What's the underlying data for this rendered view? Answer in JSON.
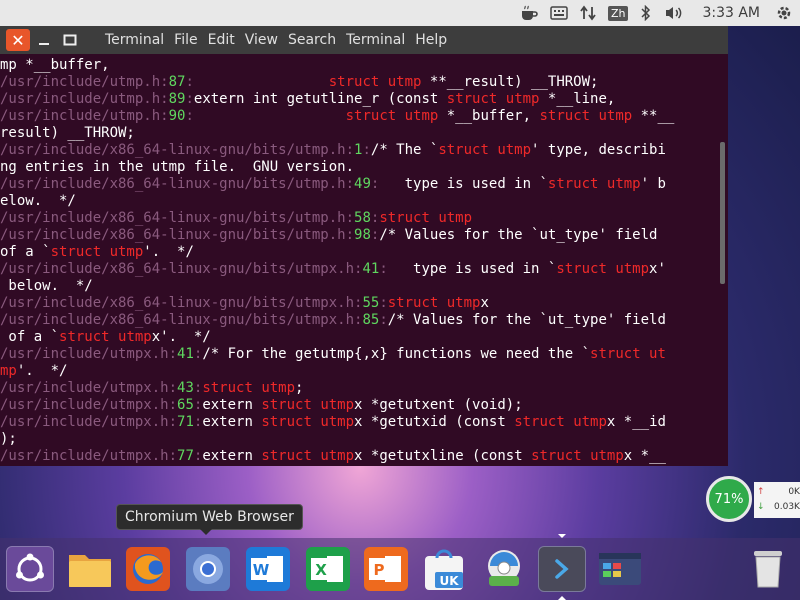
{
  "top_panel": {
    "input_method": "Zh",
    "clock": "3:33 AM",
    "icons": [
      "coffee-icon",
      "keyboard-icon",
      "network-transfer-icon",
      "bluetooth-icon",
      "volume-icon",
      "settings-gear-icon"
    ]
  },
  "terminal": {
    "menus": [
      "Terminal",
      "File",
      "Edit",
      "View",
      "Search",
      "Terminal",
      "Help"
    ],
    "lines": [
      [
        {
          "t": "mp *__buffer,",
          "c": ""
        }
      ],
      [
        {
          "t": "/usr/include/utmp.h",
          "c": "p"
        },
        {
          "t": ":",
          "c": "p"
        },
        {
          "t": "87",
          "c": "n"
        },
        {
          "t": ":",
          "c": "p"
        },
        {
          "t": "                ",
          "c": ""
        },
        {
          "t": "struct utmp",
          "c": "k"
        },
        {
          "t": " **__result) __THROW;",
          "c": ""
        }
      ],
      [
        {
          "t": "/usr/include/utmp.h",
          "c": "p"
        },
        {
          "t": ":",
          "c": "p"
        },
        {
          "t": "89",
          "c": "n"
        },
        {
          "t": ":",
          "c": "p"
        },
        {
          "t": "extern int getutline_r (const ",
          "c": ""
        },
        {
          "t": "struct utmp",
          "c": "k"
        },
        {
          "t": " *__line,",
          "c": ""
        }
      ],
      [
        {
          "t": "/usr/include/utmp.h",
          "c": "p"
        },
        {
          "t": ":",
          "c": "p"
        },
        {
          "t": "90",
          "c": "n"
        },
        {
          "t": ":",
          "c": "p"
        },
        {
          "t": "                  ",
          "c": ""
        },
        {
          "t": "struct utmp",
          "c": "k"
        },
        {
          "t": " *__buffer, ",
          "c": ""
        },
        {
          "t": "struct utmp",
          "c": "k"
        },
        {
          "t": " **__",
          "c": ""
        }
      ],
      [
        {
          "t": "result) __THROW;",
          "c": ""
        }
      ],
      [
        {
          "t": "/usr/include/x86_64-linux-gnu/bits/utmp.h",
          "c": "p"
        },
        {
          "t": ":",
          "c": "p"
        },
        {
          "t": "1",
          "c": "n"
        },
        {
          "t": ":",
          "c": "p"
        },
        {
          "t": "/* The `",
          "c": ""
        },
        {
          "t": "struct utmp",
          "c": "k"
        },
        {
          "t": "' type, describi",
          "c": ""
        }
      ],
      [
        {
          "t": "ng entries in the utmp file.  GNU version.",
          "c": ""
        }
      ],
      [
        {
          "t": "/usr/include/x86_64-linux-gnu/bits/utmp.h",
          "c": "p"
        },
        {
          "t": ":",
          "c": "p"
        },
        {
          "t": "49",
          "c": "n"
        },
        {
          "t": ":",
          "c": "p"
        },
        {
          "t": "   type is used in `",
          "c": ""
        },
        {
          "t": "struct utmp",
          "c": "k"
        },
        {
          "t": "' b",
          "c": ""
        }
      ],
      [
        {
          "t": "elow.  */",
          "c": ""
        }
      ],
      [
        {
          "t": "/usr/include/x86_64-linux-gnu/bits/utmp.h",
          "c": "p"
        },
        {
          "t": ":",
          "c": "p"
        },
        {
          "t": "58",
          "c": "n"
        },
        {
          "t": ":",
          "c": "p"
        },
        {
          "t": "struct utmp",
          "c": "k"
        }
      ],
      [
        {
          "t": "/usr/include/x86_64-linux-gnu/bits/utmp.h",
          "c": "p"
        },
        {
          "t": ":",
          "c": "p"
        },
        {
          "t": "98",
          "c": "n"
        },
        {
          "t": ":",
          "c": "p"
        },
        {
          "t": "/* Values for the `ut_type' field",
          "c": ""
        }
      ],
      [
        {
          "t": "of a `",
          "c": ""
        },
        {
          "t": "struct utmp",
          "c": "k"
        },
        {
          "t": "'.  */",
          "c": ""
        }
      ],
      [
        {
          "t": "/usr/include/x86_64-linux-gnu/bits/utmpx.h",
          "c": "p"
        },
        {
          "t": ":",
          "c": "p"
        },
        {
          "t": "41",
          "c": "n"
        },
        {
          "t": ":",
          "c": "p"
        },
        {
          "t": "   type is used in `",
          "c": ""
        },
        {
          "t": "struct utmp",
          "c": "k"
        },
        {
          "t": "x'",
          "c": ""
        }
      ],
      [
        {
          "t": " below.  */",
          "c": ""
        }
      ],
      [
        {
          "t": "/usr/include/x86_64-linux-gnu/bits/utmpx.h",
          "c": "p"
        },
        {
          "t": ":",
          "c": "p"
        },
        {
          "t": "55",
          "c": "n"
        },
        {
          "t": ":",
          "c": "p"
        },
        {
          "t": "struct utmp",
          "c": "k"
        },
        {
          "t": "x",
          "c": ""
        }
      ],
      [
        {
          "t": "/usr/include/x86_64-linux-gnu/bits/utmpx.h",
          "c": "p"
        },
        {
          "t": ":",
          "c": "p"
        },
        {
          "t": "85",
          "c": "n"
        },
        {
          "t": ":",
          "c": "p"
        },
        {
          "t": "/* Values for the `ut_type' field",
          "c": ""
        }
      ],
      [
        {
          "t": " of a `",
          "c": ""
        },
        {
          "t": "struct utmp",
          "c": "k"
        },
        {
          "t": "x'.  */",
          "c": ""
        }
      ],
      [
        {
          "t": "/usr/include/utmpx.h",
          "c": "p"
        },
        {
          "t": ":",
          "c": "p"
        },
        {
          "t": "41",
          "c": "n"
        },
        {
          "t": ":",
          "c": "p"
        },
        {
          "t": "/* For the getutmp{,x} functions we need the `",
          "c": ""
        },
        {
          "t": "struct ut",
          "c": "k"
        }
      ],
      [
        {
          "t": "mp",
          "c": "k"
        },
        {
          "t": "'.  */",
          "c": ""
        }
      ],
      [
        {
          "t": "/usr/include/utmpx.h",
          "c": "p"
        },
        {
          "t": ":",
          "c": "p"
        },
        {
          "t": "43",
          "c": "n"
        },
        {
          "t": ":",
          "c": "p"
        },
        {
          "t": "struct utmp",
          "c": "k"
        },
        {
          "t": ";",
          "c": ""
        }
      ],
      [
        {
          "t": "/usr/include/utmpx.h",
          "c": "p"
        },
        {
          "t": ":",
          "c": "p"
        },
        {
          "t": "65",
          "c": "n"
        },
        {
          "t": ":",
          "c": "p"
        },
        {
          "t": "extern ",
          "c": ""
        },
        {
          "t": "struct utmp",
          "c": "k"
        },
        {
          "t": "x *getutxent (void);",
          "c": ""
        }
      ],
      [
        {
          "t": "/usr/include/utmpx.h",
          "c": "p"
        },
        {
          "t": ":",
          "c": "p"
        },
        {
          "t": "71",
          "c": "n"
        },
        {
          "t": ":",
          "c": "p"
        },
        {
          "t": "extern ",
          "c": ""
        },
        {
          "t": "struct utmp",
          "c": "k"
        },
        {
          "t": "x *getutxid (const ",
          "c": ""
        },
        {
          "t": "struct utmp",
          "c": "k"
        },
        {
          "t": "x *__id",
          "c": ""
        }
      ],
      [
        {
          "t": ");",
          "c": ""
        }
      ],
      [
        {
          "t": "/usr/include/utmpx.h",
          "c": "p"
        },
        {
          "t": ":",
          "c": "p"
        },
        {
          "t": "77",
          "c": "n"
        },
        {
          "t": ":",
          "c": "p"
        },
        {
          "t": "extern ",
          "c": ""
        },
        {
          "t": "struct utmp",
          "c": "k"
        },
        {
          "t": "x *getutxline (const ",
          "c": ""
        },
        {
          "t": "struct utmp",
          "c": "k"
        },
        {
          "t": "x *__",
          "c": ""
        }
      ]
    ]
  },
  "net_widget": {
    "cpu_percent": "71%",
    "upload": "0K/",
    "download": "0.03K/"
  },
  "tooltip": "Chromium Web Browser",
  "dock": {
    "items": [
      {
        "name": "dash-home-icon"
      },
      {
        "name": "files-icon"
      },
      {
        "name": "firefox-icon"
      },
      {
        "name": "chromium-icon"
      },
      {
        "name": "wps-writer-icon"
      },
      {
        "name": "wps-spreadsheets-icon"
      },
      {
        "name": "wps-presentation-icon"
      },
      {
        "name": "ubuntu-software-icon"
      },
      {
        "name": "system-monitor-icon"
      },
      {
        "name": "terminal-icon"
      },
      {
        "name": "workspace-switcher-icon"
      },
      {
        "name": "trash-icon"
      }
    ]
  }
}
